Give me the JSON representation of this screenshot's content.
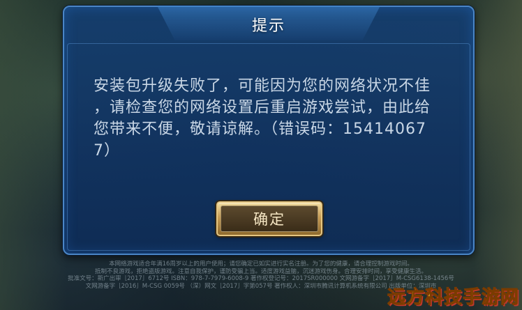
{
  "dialog": {
    "title": "提示",
    "message_lines": [
      "安装包升级失败了，可能因为您的网络状况不佳",
      "，请检查您的网络设置后重启游戏尝试，由此给",
      "您带来不便，敬请谅解。（错误码：15414067",
      "7）"
    ],
    "confirm_label": "确定"
  },
  "footer": {
    "lines": [
      "本网络游戏适合年满16周岁以上的用户使用；请您确定已如实进行实名注册。为了您的健康，请合理控制游戏时间。",
      "抵制不良游戏，拒绝盗版游戏。注意自我保护，谨防受骗上当。适度游戏益脑，沉迷游戏伤身。合理安排时间，享受健康生活。",
      "批准文号：新广出审［2017］6712号 ISBN：978-7-7979-6008-9 著作权登记号：2017SR000000 文网游备字［2017］M-CSG6138-1456号",
      "文网游备字［2016］M-CSG 0059号  （深）网文［2017］字第057号  著作权人：深圳市腾讯计算机系统有限公司 出版单位：深圳市"
    ]
  },
  "watermark": "远方科技手游网",
  "colors": {
    "dialog_border": "#4a86c6",
    "dialog_bg": "#143e70",
    "button_gold": "#c69b54",
    "watermark": "#ffe14a"
  }
}
